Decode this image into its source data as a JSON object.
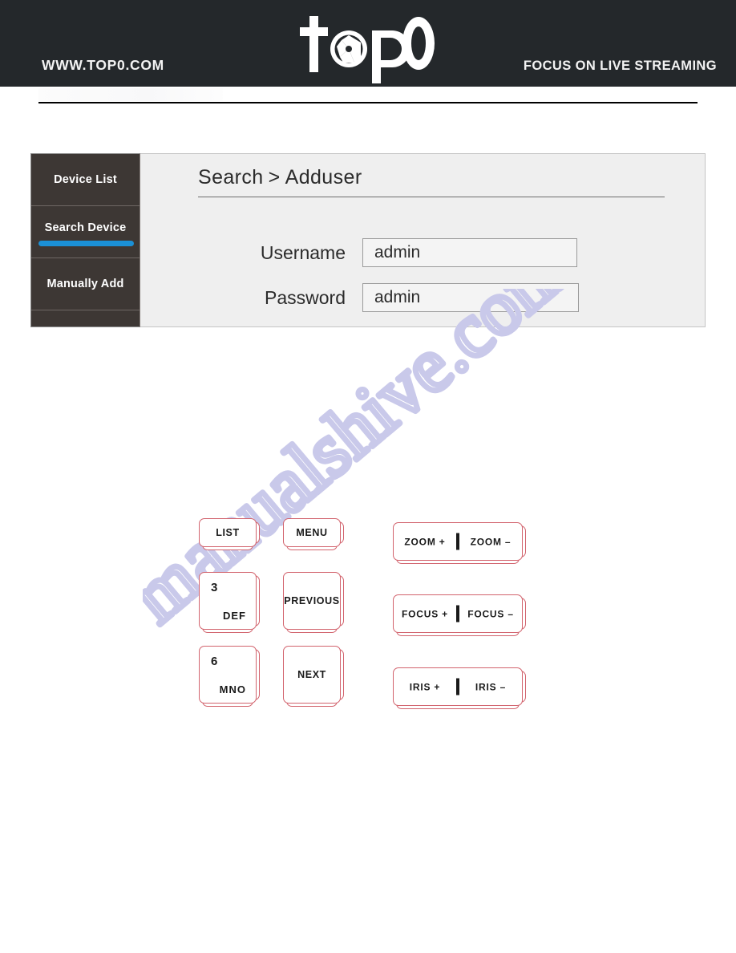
{
  "header": {
    "site_url": "WWW.TOP0.COM",
    "tagline": "FOCUS ON LIVE STREAMING",
    "logo_text": "top0",
    "logo_icon": "camera-aperture-icon",
    "background_color": "#24282b"
  },
  "sidebar": {
    "items": [
      {
        "label": "Device List",
        "active": false
      },
      {
        "label": "Search Device",
        "active": true
      },
      {
        "label": "Manually Add",
        "active": false
      },
      {
        "label": "",
        "active": false
      }
    ],
    "active_accent_color": "#1b90d6",
    "background_color": "#3d3734"
  },
  "panel": {
    "breadcrumb": {
      "root": "Search",
      "separator": ">",
      "current": "Adduser"
    },
    "background_color": "#efefef",
    "fields": [
      {
        "label": "Username",
        "value": "admin",
        "placeholder": "Username"
      },
      {
        "label": "Password",
        "value": "admin",
        "placeholder": "Password"
      }
    ]
  },
  "watermark": {
    "text": "manualshive.com",
    "color": "#c9c9ea"
  },
  "keypad": {
    "keys": [
      {
        "id": "list",
        "type": "simple",
        "label": "LIST"
      },
      {
        "id": "menu",
        "type": "simple",
        "label": "MENU"
      },
      {
        "id": "three",
        "type": "numeric",
        "digit": "3",
        "letters": "DEF"
      },
      {
        "id": "previous",
        "type": "simple",
        "label": "PREVIOUS"
      },
      {
        "id": "six",
        "type": "numeric",
        "digit": "6",
        "letters": "MNO"
      },
      {
        "id": "next",
        "type": "simple",
        "label": "NEXT"
      },
      {
        "id": "zoom",
        "type": "dual",
        "left_label": "ZOOM +",
        "right_label": "ZOOM –"
      },
      {
        "id": "focus",
        "type": "dual",
        "left_label": "FOCUS +",
        "right_label": "FOCUS –"
      },
      {
        "id": "iris",
        "type": "dual",
        "left_label": "IRIS +",
        "right_label": "IRIS –"
      }
    ],
    "outline_color": "#d2636d"
  }
}
